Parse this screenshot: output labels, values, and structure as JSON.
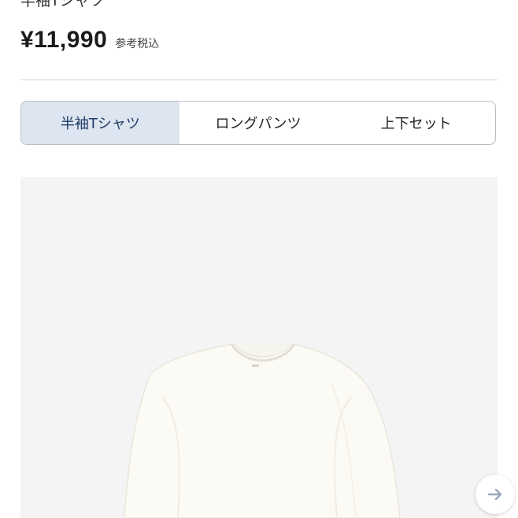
{
  "product": {
    "title": "半袖Tシャツ",
    "price": "¥11,990",
    "tax_note": "参考税込"
  },
  "variant_tabs": [
    {
      "label": "半袖Tシャツ",
      "selected": true
    },
    {
      "label": "ロングパンツ",
      "selected": false
    },
    {
      "label": "上下セット",
      "selected": false
    }
  ],
  "gallery": {
    "image": "white-short-sleeve-knit-tshirt",
    "next_icon": "arrow-right-icon"
  },
  "colors": {
    "selected_tab_bg": "#dde5f0",
    "selected_tab_text": "#1f3c66",
    "image_bg": "#f4f4f4"
  }
}
